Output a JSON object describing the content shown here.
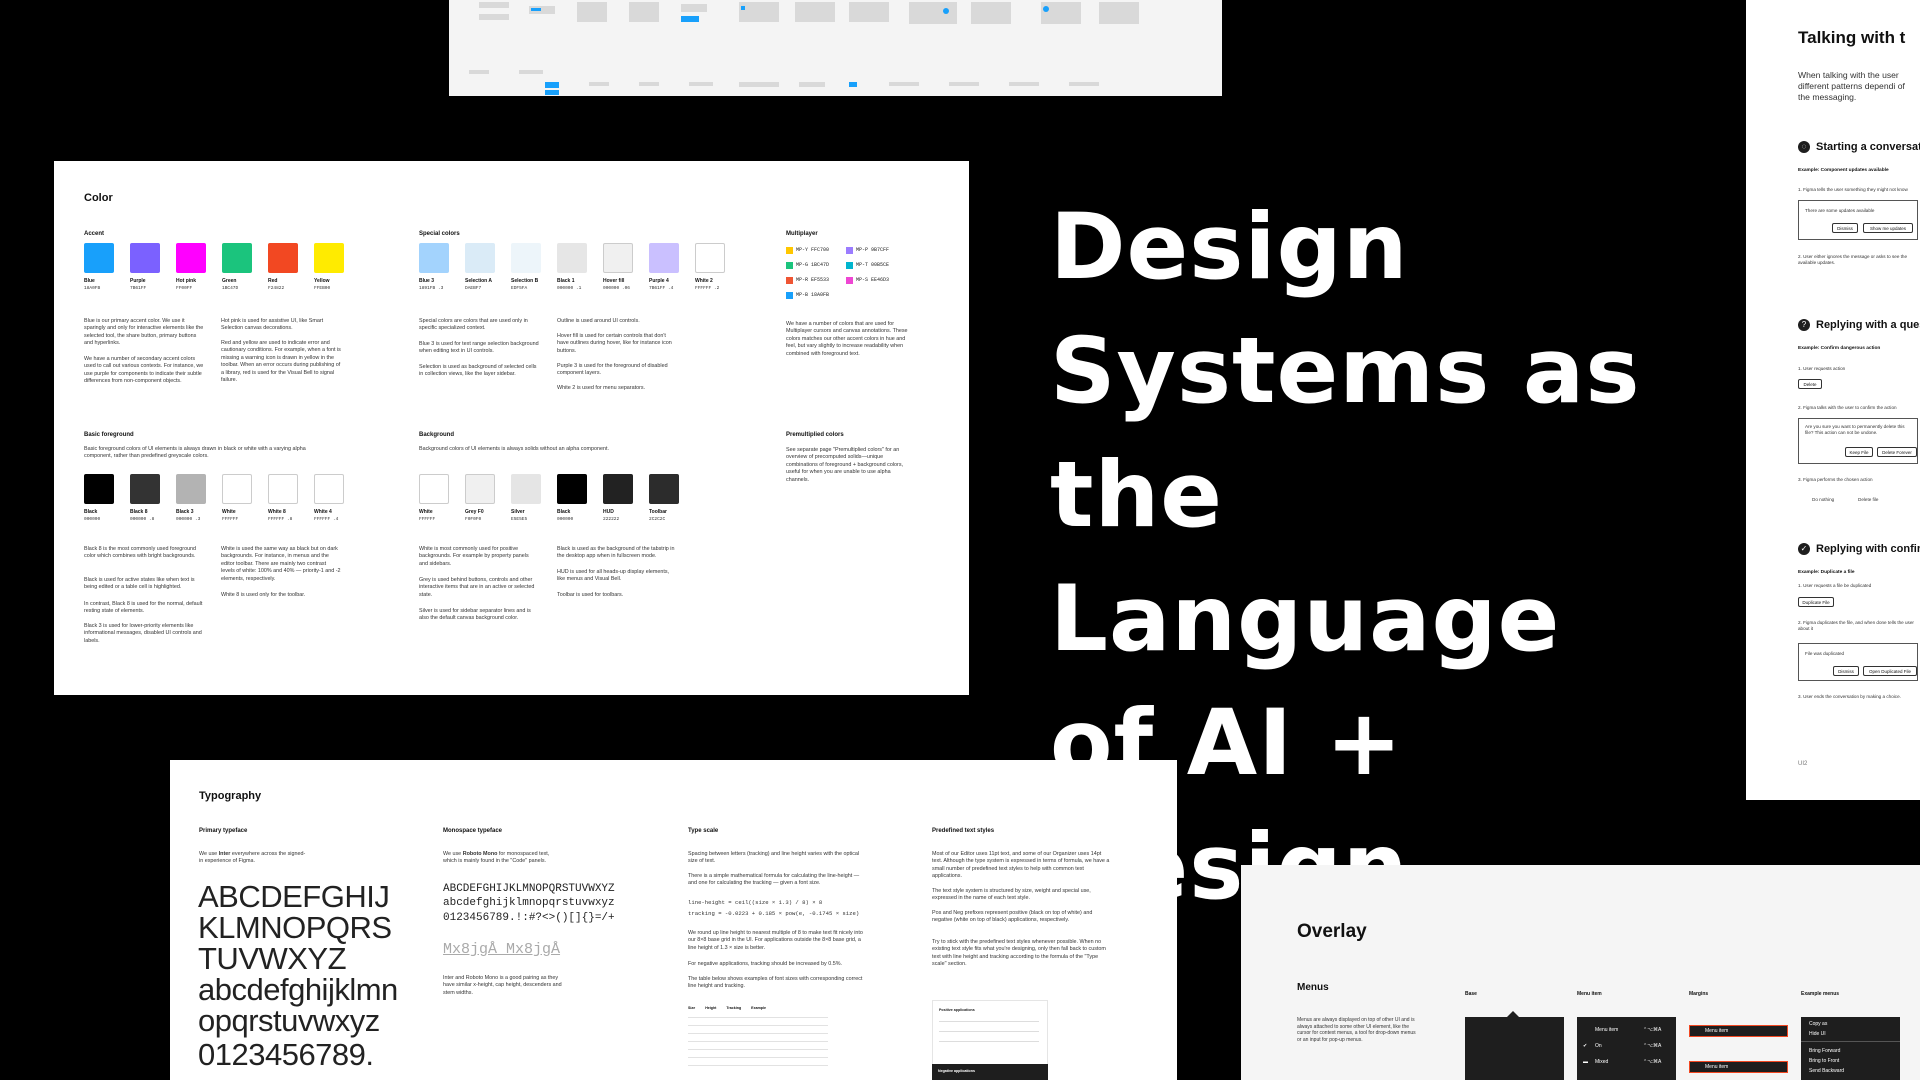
{
  "hero": {
    "line1": "Design",
    "line2": "Systems as",
    "line3": "the Language",
    "line4": "of AI + Design"
  },
  "color_card": {
    "title": "Color",
    "accent": {
      "title": "Accent",
      "swatches": [
        {
          "name": "Blue",
          "hex": "18A0FB",
          "color": "#18A0FB"
        },
        {
          "name": "Purple",
          "hex": "7B61FF",
          "color": "#7B61FF"
        },
        {
          "name": "Hot pink",
          "hex": "FF00FF",
          "color": "#FF00FF"
        },
        {
          "name": "Green",
          "hex": "1BC47D",
          "color": "#1BC47D"
        },
        {
          "name": "Red",
          "hex": "F24822",
          "color": "#F24822"
        },
        {
          "name": "Yellow",
          "hex": "FFEB00",
          "color": "#FFEB00"
        }
      ],
      "para1": "Blue is our primary accent color. We use it sparingly and only for interactive elements like the selected tool, the share button, primary buttons and hyperlinks.",
      "para2": "We have a number of secondary accent colors used to call out various contexts. For instance, we use purple for components to indicate their subtle differences from non-component objects.",
      "para3": "Hot pink is used for assistive UI, like Smart Selection canvas decorations.",
      "para4": "Red and yellow are used to indicate error and cautionary conditions. For example, when a font is missing a warning icon is drawn in yellow in the toolbar. When an error occurs during publishing of a library, red is used for the Visual Bell to signal failure."
    },
    "special": {
      "title": "Special colors",
      "swatches": [
        {
          "name": "Blue 3",
          "hex": "1891FB .3",
          "color": "#A3D3FD"
        },
        {
          "name": "Selection A",
          "hex": "DAEBF7",
          "color": "#DAEBF7"
        },
        {
          "name": "Selection B",
          "hex": "EDF5FA",
          "color": "#EDF5FA"
        },
        {
          "name": "Black 1",
          "hex": "000000 .1",
          "color": "#E6E6E6"
        },
        {
          "name": "Hover fill",
          "hex": "000000 .06",
          "color": "#F0F0F0"
        },
        {
          "name": "Purple 4",
          "hex": "7B61FF .4",
          "color": "#CAC0FF"
        },
        {
          "name": "White 2",
          "hex": "FFFFFF .2",
          "color": "#FFFFFF"
        }
      ],
      "para1": "Special colors are colors that are used only in specific specialized context.",
      "para2": "Blue 3 is used for text range selection background when editing text in UI controls.",
      "para3": "Selection is used as background of selected cells in collection views, like the layer sidebar.",
      "para4": "Outline is used around UI controls.",
      "para5": "Hover fill is used for certain controls that don't have outlines during hover, like for instance icon buttons.",
      "para6": "Purple 3 is used for the foreground of disabled component layers.",
      "para7": "White 2 is used for menu separators."
    },
    "multiplayer": {
      "title": "Multiplayer",
      "items": [
        {
          "label": "MP-Y FFC700",
          "color": "#FFC700"
        },
        {
          "label": "MP-P 9B7CFF",
          "color": "#9B7CFF"
        },
        {
          "label": "MP-G 1BC47D",
          "color": "#1BC47D"
        },
        {
          "label": "MP-T 00B5CE",
          "color": "#00B5CE"
        },
        {
          "label": "MP-R EF5533",
          "color": "#EF5533"
        },
        {
          "label": "MP-S EE46D3",
          "color": "#EE46D3"
        },
        {
          "label": "MP-B 18A0FB",
          "color": "#18A0FB"
        }
      ],
      "para": "We have a number of colors that are used for Multiplayer cursors and canvas annotations. These colors matches our other accent colors in hue and feel, but vary slightly to increase readability when combined with foreground text."
    },
    "basic_fg": {
      "title": "Basic foreground",
      "intro": "Basic foreground colors of UI elements is always drawn in black or white with a varying alpha component, rather than predefined greyscale colors.",
      "swatches": [
        {
          "name": "Black",
          "hex": "000000",
          "color": "#000000"
        },
        {
          "name": "Black 8",
          "hex": "000000 .8",
          "color": "#333333"
        },
        {
          "name": "Black 3",
          "hex": "000000 .3",
          "color": "#B3B3B3"
        },
        {
          "name": "White",
          "hex": "FFFFFF",
          "color": "#FFFFFF"
        },
        {
          "name": "White 8",
          "hex": "FFFFFF .8",
          "color": "#FFFFFF"
        },
        {
          "name": "White 4",
          "hex": "FFFFFF .4",
          "color": "#FFFFFF"
        }
      ],
      "para1": "Black 8 is the most commonly used foreground color which combines with bright backgrounds.",
      "para2": "Black is used for active states like when text is being edited or a table cell is highlighted.",
      "para3": "In contrast, Black 8 is used for the normal, default resting state of elements.",
      "para4": "Black 3 is used for lower-priority elements like informational messages, disabled UI controls and labels.",
      "para5": "White is used the same way as black but on dark backgrounds. For instance, in menus and the editor toolbar. There are mainly two contrast levels of white: 100% and 40% — priority-1 and -2 elements, respectively.",
      "para6": "White 8 is used only for the toolbar."
    },
    "background": {
      "title": "Background",
      "intro": "Background colors of UI elements is always solids without an alpha component.",
      "swatches": [
        {
          "name": "White",
          "hex": "FFFFFF",
          "color": "#FFFFFF"
        },
        {
          "name": "Grey F0",
          "hex": "F0F0F0",
          "color": "#F0F0F0"
        },
        {
          "name": "Silver",
          "hex": "E5E5E5",
          "color": "#E5E5E5"
        },
        {
          "name": "Black",
          "hex": "000000",
          "color": "#000000"
        },
        {
          "name": "HUD",
          "hex": "222222",
          "color": "#222222"
        },
        {
          "name": "Toolbar",
          "hex": "2C2C2C",
          "color": "#2C2C2C"
        }
      ],
      "para1": "White is most commonly used for positive backgrounds. For example by property panels and sidebars.",
      "para2": "Grey is used behind buttons, controls and other interactive items that are in an active or selected state.",
      "para3": "Silver is used for sidebar separator lines and is also the default canvas background color.",
      "para4": "Black is used as the background of the tabstrip in the desktop app when in fullscreen mode.",
      "para5": "HUD is used for all heads-up display elements, like menus and Visual Bell.",
      "para6": "Toolbar is used for toolbars."
    },
    "premultiplied": {
      "title": "Premultiplied colors",
      "para": "See separate page \"Premultiplied colors\" for an overview of precomputed solids—unique combinations of foreground + background colors, useful for when you are unable to use alpha channels."
    }
  },
  "talk_card": {
    "title": "Talking with t",
    "intro": "When talking with the user different patterns dependi of the messaging.",
    "sec1": {
      "title": "Starting a conversati",
      "example": "Example: Component updates available",
      "step1": "1. Figma tells the user something they might not know",
      "box_text": "There are some updates available",
      "btn1": "Dismiss",
      "btn2": "Show me updates",
      "step2": "2. User either ignores the message or asks to see the available updates."
    },
    "sec2": {
      "title": "Replying with a quest",
      "example": "Example: Confirm dangerous action",
      "step1": "1. User requests action",
      "btn_delete": "Delete",
      "step2": "2. Figma talks with the user to confirm the action",
      "box_text": "Are you sure you want to permanently delete this file? This action can not be undone.",
      "btn1": "Keep File",
      "btn2": "Delete Forever",
      "step3": "3. Figma performs the chosen action",
      "opt1": "Do nothing",
      "opt2": "Delete file"
    },
    "sec3": {
      "title": "Replying with confirm",
      "example": "Example: Duplicate a file",
      "step1": "1. User requests a file be duplicated",
      "btn_dup": "Duplicate File",
      "step2": "2. Figma duplicates the file, and when done tells the user about it",
      "box_text": "File was duplicated",
      "btn1": "Dismiss",
      "btn2": "Open Duplicated File",
      "step3": "3. User ends the conversation by making a choice."
    },
    "footer": "UI2"
  },
  "typo_card": {
    "title": "Typography",
    "primary": {
      "title": "Primary typeface",
      "desc_pre": "We use ",
      "font": "Inter",
      "desc_post": " everywhere across the signed-in experience of Figma.",
      "alpha1": "ABCDEFGHIJ",
      "alpha2": "KLMNOPQRS",
      "alpha3": "TUVWXYZ",
      "alpha4": "abcdefghijklmn",
      "alpha5": "opqrstuvwxyz",
      "alpha6": "0123456789."
    },
    "mono": {
      "title": "Monospace typeface",
      "desc_pre": "We use ",
      "font": "Roboto Mono",
      "desc_post": " for monospaced text, which is mainly found in the \"Code\" panels.",
      "alpha1": "ABCDEFGHIJKLMNOPQRSTUVWXYZ",
      "alpha2": "abcdefghijklmnopqrstuvwxyz",
      "alpha3": "0123456789.!:#?<>()[]{}=/+",
      "sample": "Mx8jgÅ Mx8jgÅ",
      "note": "Inter and Roboto Mono is a good pairing as they have similar x-height, cap height, descenders and stem widths."
    },
    "scale": {
      "title": "Type scale",
      "p1": "Spacing between letters (tracking) and line height varies with the optical size of text.",
      "p2": "There is a simple mathematical formula for calculating the line-height — and one for calculating the tracking — given a font size.",
      "f1": "line-height = ceil((size × 1.3) / 8) × 8",
      "f2": "tracking = -0.0223 + 0.185 × pow(e, -0.1745 × size)",
      "p3": "We round up line height to nearest multiple of 8 to make text fit nicely into our 8×8 base grid in the UI. For applications outside the 8×8 base grid, a line height of 1.3 × size is better.",
      "p4": "For negative applications, tracking should be increased by 0.5%.",
      "p5": "The table below shows examples of font sizes with corresponding correct line height and tracking.",
      "cols": [
        "Size",
        "Height",
        "Tracking",
        "Example"
      ]
    },
    "predef": {
      "title": "Predefined text styles",
      "p1": "Most of our Editor uses 11pt text, and some of our Organizer uses 14pt text. Although the type system is expressed in terms of formula, we have a small number of predefined text styles to help with common text applications.",
      "p2": "The text style system is structured by size, weight and special use, expressed in the name of each text style.",
      "p3": "Pos and Neg prefixes represent positive (black on top of white) and negative (white on top of black) applications, respectively.",
      "p4": "Try to stick with the predefined text styles whenever possible. When no existing text style fits what you're designing, only then fall back to custom text with line height and tracking according to the formula of the \"Type scale\" section.",
      "panel1": "Positive applications",
      "panel2": "Negative applications"
    }
  },
  "overlay_card": {
    "title": "Overlay",
    "menus_title": "Menus",
    "menus_desc": "Menus are always displayed on top of other UI and is always attached to some other UI element, like the cursor for context menus, a tool for drop-down menus or an input for pop-up menus.",
    "col_base": "Base",
    "col_item": "Menu item",
    "col_margins": "Margins",
    "col_examples": "Example menus",
    "item_row1": "Menu item",
    "item_row2": "On",
    "item_row3": "Mixed",
    "shortcut": "⌃⌥⌘A",
    "margin_row": "Menu item",
    "ex1": "Copy as",
    "ex2": "Hide UI",
    "ex3": "Bring Forward",
    "ex4": "Bring to Front",
    "ex5": "Send Backward"
  }
}
